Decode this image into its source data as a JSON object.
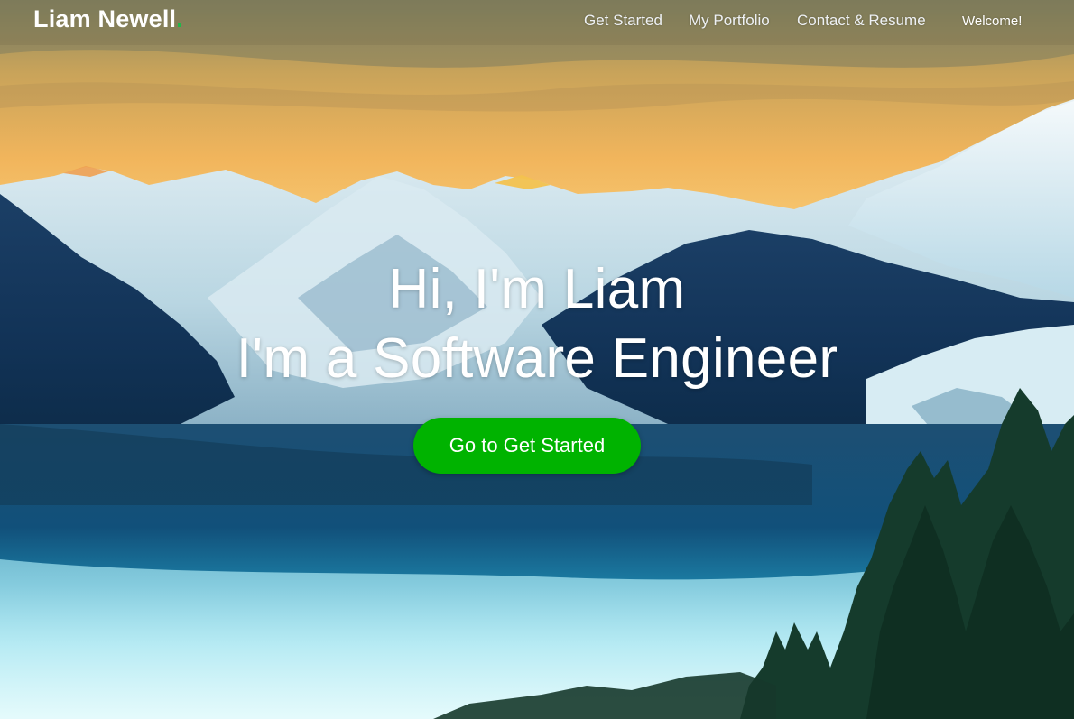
{
  "nav": {
    "brand": "Liam Newell",
    "brand_dot": ".",
    "links": [
      "Get Started",
      "My Portfolio",
      "Contact & Resume",
      "Welcome!"
    ]
  },
  "hero": {
    "line1": "Hi, I'm Liam",
    "line2": "I'm a Software Engineer",
    "cta_label": "Go to Get Started"
  },
  "colors": {
    "accent": "#00b300",
    "brand_dot": "#1fb84a",
    "text": "#ffffff"
  }
}
